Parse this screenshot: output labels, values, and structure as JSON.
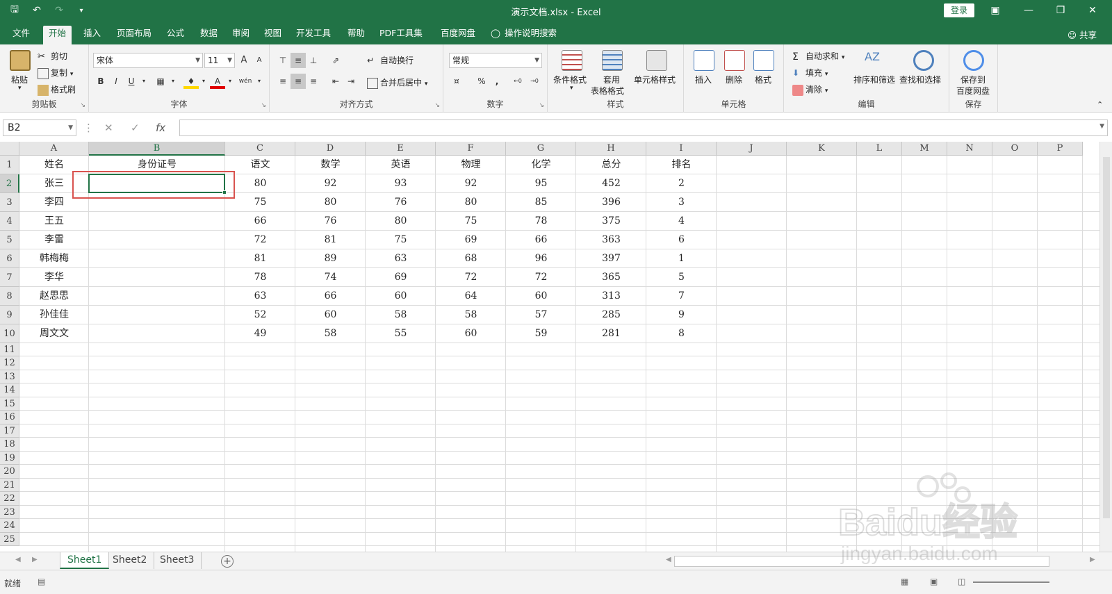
{
  "window": {
    "title": "演示文档.xlsx - Excel",
    "login_label": "登录",
    "share_label": "共享"
  },
  "menu": {
    "tabs": [
      "文件",
      "开始",
      "插入",
      "页面布局",
      "公式",
      "数据",
      "审阅",
      "视图",
      "开发工具",
      "帮助",
      "PDF工具集",
      "百度网盘"
    ],
    "active_index": 1,
    "tell_me": "操作说明搜索"
  },
  "ribbon": {
    "clipboard": {
      "label": "剪贴板",
      "paste": "粘贴",
      "cut": "剪切",
      "copy": "复制",
      "format_painter": "格式刷"
    },
    "font": {
      "label": "字体",
      "font_name": "宋体",
      "font_size": "11",
      "bold": "B",
      "italic": "I",
      "underline": "U",
      "grow": "A",
      "shrink": "A",
      "color_a": "A",
      "phonetic": "wén"
    },
    "alignment": {
      "label": "对齐方式",
      "wrap_text": "自动换行",
      "merge_center": "合并后居中"
    },
    "number": {
      "label": "数字",
      "format": "常规",
      "percent": "%",
      "comma": ","
    },
    "styles": {
      "label": "样式",
      "conditional": "条件格式",
      "table_format_1": "套用",
      "table_format_2": "表格格式",
      "cell_styles": "单元格样式"
    },
    "cells": {
      "label": "单元格",
      "insert": "插入",
      "delete": "删除",
      "format": "格式"
    },
    "editing": {
      "label": "编辑",
      "autosum": "自动求和",
      "fill": "填充",
      "clear": "清除",
      "sort_filter": "排序和筛选",
      "find_select": "查找和选择"
    },
    "save": {
      "label": "保存",
      "save_to_1": "保存到",
      "save_to_2": "百度网盘"
    }
  },
  "formula_bar": {
    "name_box": "B2",
    "fx": "fx",
    "value": ""
  },
  "grid": {
    "columns": [
      "A",
      "B",
      "C",
      "D",
      "E",
      "F",
      "G",
      "H",
      "I",
      "J",
      "K",
      "L",
      "M",
      "N",
      "O",
      "P"
    ],
    "row_numbers": [
      "1",
      "2",
      "3",
      "4",
      "5",
      "6",
      "7",
      "8",
      "9",
      "10",
      "11",
      "12",
      "13",
      "14",
      "15",
      "16",
      "17",
      "18",
      "19",
      "20",
      "21",
      "22",
      "23",
      "24",
      "25"
    ],
    "selected_cell": "B2",
    "rows": [
      [
        "姓名",
        "身份证号",
        "语文",
        "数学",
        "英语",
        "物理",
        "化学",
        "总分",
        "排名"
      ],
      [
        "张三",
        "",
        "80",
        "92",
        "93",
        "92",
        "95",
        "452",
        "2"
      ],
      [
        "李四",
        "",
        "75",
        "80",
        "76",
        "80",
        "85",
        "396",
        "3"
      ],
      [
        "王五",
        "",
        "66",
        "76",
        "80",
        "75",
        "78",
        "375",
        "4"
      ],
      [
        "李雷",
        "",
        "72",
        "81",
        "75",
        "69",
        "66",
        "363",
        "6"
      ],
      [
        "韩梅梅",
        "",
        "81",
        "89",
        "63",
        "68",
        "96",
        "397",
        "1"
      ],
      [
        "李华",
        "",
        "78",
        "74",
        "69",
        "72",
        "72",
        "365",
        "5"
      ],
      [
        "赵思思",
        "",
        "63",
        "66",
        "60",
        "64",
        "60",
        "313",
        "7"
      ],
      [
        "孙佳佳",
        "",
        "52",
        "60",
        "58",
        "58",
        "57",
        "285",
        "9"
      ],
      [
        "周文文",
        "",
        "49",
        "58",
        "55",
        "60",
        "59",
        "281",
        "8"
      ]
    ]
  },
  "sheets": {
    "tabs": [
      "Sheet1",
      "Sheet2",
      "Sheet3"
    ],
    "active_index": 0
  },
  "status": {
    "ready": "就绪"
  },
  "watermark": {
    "line1": "Baidu经验",
    "line2": "jingyan.baidu.com"
  }
}
